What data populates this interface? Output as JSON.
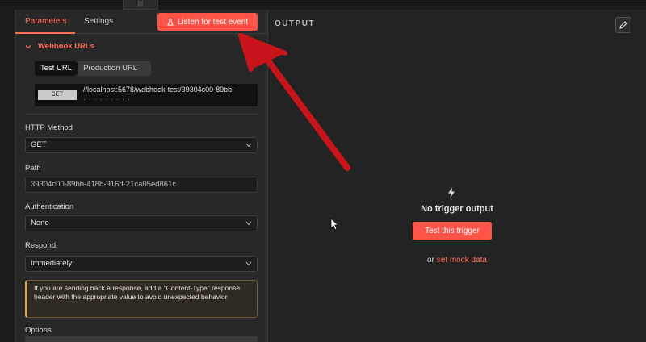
{
  "tabs": {
    "parameters": "Parameters",
    "settings": "Settings"
  },
  "listen_button": "Listen for test event",
  "webhook": {
    "section_title": "Webhook URLs",
    "url_tabs": [
      "Test URL",
      "Production URL"
    ],
    "method": "GET",
    "url_line1": "//localhost:5678/webhook-test/39304c00-89bb-",
    "url_line2": "· · ·  · ·  ·  · · ·"
  },
  "fields": {
    "http_method_label": "HTTP Method",
    "http_method_value": "GET",
    "path_label": "Path",
    "path_value": "39304c00-89bb-418b-916d-21ca05ed861c",
    "auth_label": "Authentication",
    "auth_value": "None",
    "respond_label": "Respond",
    "respond_value": "Immediately",
    "notice": "If you are sending back a response, add a \"Content-Type\" response header with the appropriate value to avoid unexpected behavior",
    "options_label": "Options"
  },
  "output": {
    "title": "OUTPUT",
    "empty_title": "No trigger output",
    "test_button": "Test this trigger",
    "or_text": "or",
    "mock_link": "set mock data"
  },
  "colors": {
    "accent": "#ff5447",
    "link": "#ff6d5a",
    "annotation": "#c8151b"
  },
  "icons": [
    "flask-icon",
    "chevron-down-icon",
    "pencil-icon",
    "bolt-icon",
    "mouse-cursor-icon",
    "red-arrow-annotation"
  ]
}
